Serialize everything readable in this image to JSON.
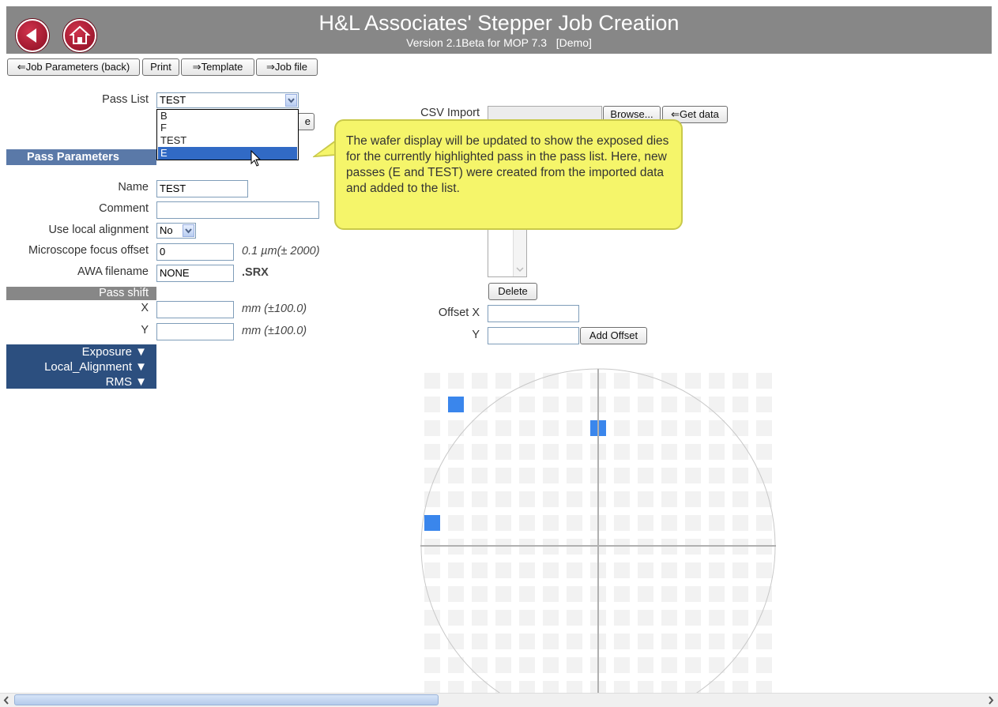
{
  "header": {
    "title": "H&L Associates' Stepper Job Creation",
    "subtitle": "Version 2.1Beta for MOP 7.3   [Demo]",
    "icons": [
      "back-icon",
      "home-icon"
    ]
  },
  "toolbar": {
    "job_parameters_back": "⇐Job Parameters (back)",
    "print": "Print",
    "template": "⇒Template",
    "job_file": "⇒Job file"
  },
  "pass_list": {
    "label": "Pass List",
    "selected": "TEST",
    "options": [
      "B",
      "F",
      "TEST",
      "E"
    ],
    "highlighted": "E",
    "hidden_button_fragment": "e"
  },
  "pass_parameters": {
    "heading": "Pass Parameters",
    "name_label": "Name",
    "name_value": "TEST",
    "comment_label": "Comment",
    "comment_value": "",
    "local_alignment_label": "Use local alignment",
    "local_alignment_value": "No",
    "focus_label": "Microscope focus offset",
    "focus_value": "0",
    "focus_hint": "0.1 µm(± 2000)",
    "awa_label": "AWA filename",
    "awa_value": "NONE",
    "awa_ext": ".SRX"
  },
  "pass_shift": {
    "heading": "Pass shift",
    "x_label": "X",
    "y_label": "Y",
    "x_value": "",
    "y_value": "",
    "x_hint": "mm (±100.0)",
    "y_hint": "mm (±100.0)"
  },
  "collapsibles": [
    "Exposure ▼",
    "Local_Alignment ▼",
    "RMS ▼"
  ],
  "csv": {
    "label": "CSV Import",
    "browse": "Browse...",
    "get_data": "⇐Get data"
  },
  "offsets": {
    "delete": "Delete",
    "offset_x_label": "Offset X",
    "y_label": "Y",
    "add_offset": "Add Offset"
  },
  "callout": {
    "text": "The wafer display will be updated to show the exposed dies for the currently highlighted pass in the pass list. Here,  new passes (E and TEST) were created from the imported data and added to the list."
  },
  "wafer": {
    "exposed_dies": [
      {
        "col": 1,
        "row": 1
      },
      {
        "col": 7,
        "row": 2
      },
      {
        "col": 0,
        "row": 6
      }
    ],
    "colors": {
      "die": "#f2f2f2",
      "exposed": "#3a86ec",
      "outline": "#c8c8c8",
      "axis": "#b0b0b0"
    }
  }
}
